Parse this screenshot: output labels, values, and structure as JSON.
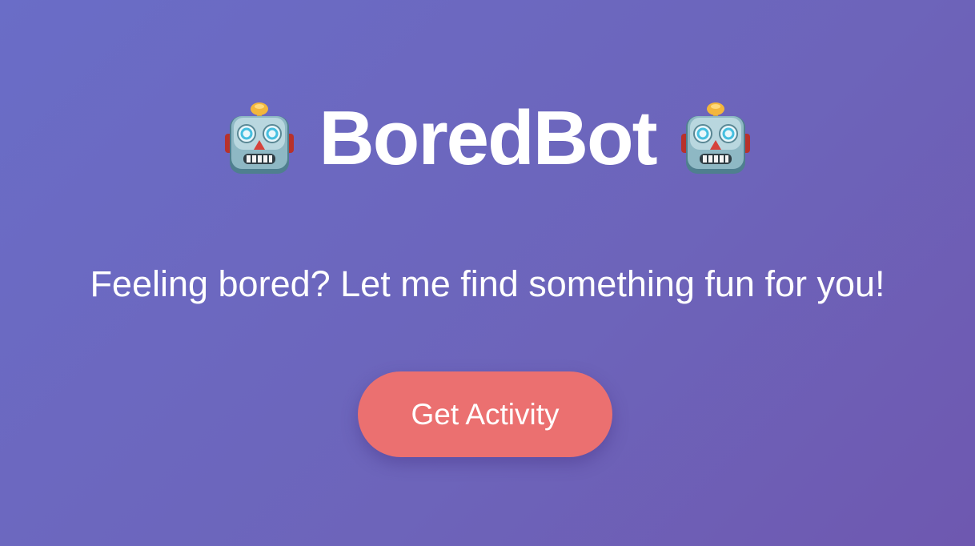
{
  "app": {
    "title": "BoredBot",
    "tagline": "Feeling bored? Let me find something fun for you!",
    "title_icon": "robot-face-emoji"
  },
  "actions": {
    "get_activity_label": "Get Activity"
  },
  "colors": {
    "background_start": "#6a6dc7",
    "background_end": "#6e58b0",
    "button": "#eb7070",
    "text": "#ffffff"
  }
}
